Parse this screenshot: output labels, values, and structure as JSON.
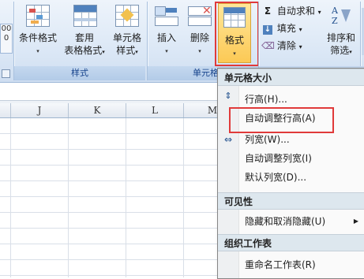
{
  "ribbon": {
    "left_stub": {
      "line1": "00",
      "line2": "0"
    },
    "styles_group": {
      "label": "样式",
      "conditional_format": {
        "label": "条件格式",
        "dropdown": "▾"
      },
      "table_format": {
        "label1": "套用",
        "label2": "表格格式",
        "dropdown": "▾"
      },
      "cell_styles": {
        "label1": "单元格",
        "label2": "样式",
        "dropdown": "▾"
      }
    },
    "cells_group": {
      "label": "单元格",
      "insert": {
        "label": "插入",
        "dropdown": "▾"
      },
      "delete": {
        "label": "删除",
        "dropdown": "▾"
      },
      "format": {
        "label": "格式",
        "dropdown": "▾"
      }
    },
    "editing_group": {
      "autosum": {
        "label": "自动求和",
        "dropdown": "▾",
        "icon": "Σ"
      },
      "fill": {
        "label": "填充",
        "dropdown": "▾"
      },
      "clear": {
        "label": "清除",
        "dropdown": "▾"
      },
      "sort_filter": {
        "label1": "排序和",
        "label2": "筛选",
        "dropdown": "▾"
      }
    }
  },
  "sheet": {
    "columns": [
      "J",
      "K",
      "L",
      "M"
    ]
  },
  "format_menu": {
    "sections": {
      "cell_size": "单元格大小",
      "visibility": "可见性",
      "organize": "组织工作表"
    },
    "items": {
      "row_height": "行高(H)...",
      "autofit_row_height": "自动调整行高(A)",
      "column_width": "列宽(W)...",
      "autofit_column_width": "自动调整列宽(I)",
      "default_width": "默认列宽(D)...",
      "hide_unhide": "隐藏和取消隐藏(U)",
      "rename_sheet": "重命名工作表(R)"
    },
    "submenu_arrow": "▶"
  },
  "colors": {
    "highlight_red": "#e03a3a",
    "ribbon_blue": "#dce8f6",
    "group_label": "#15428b"
  }
}
